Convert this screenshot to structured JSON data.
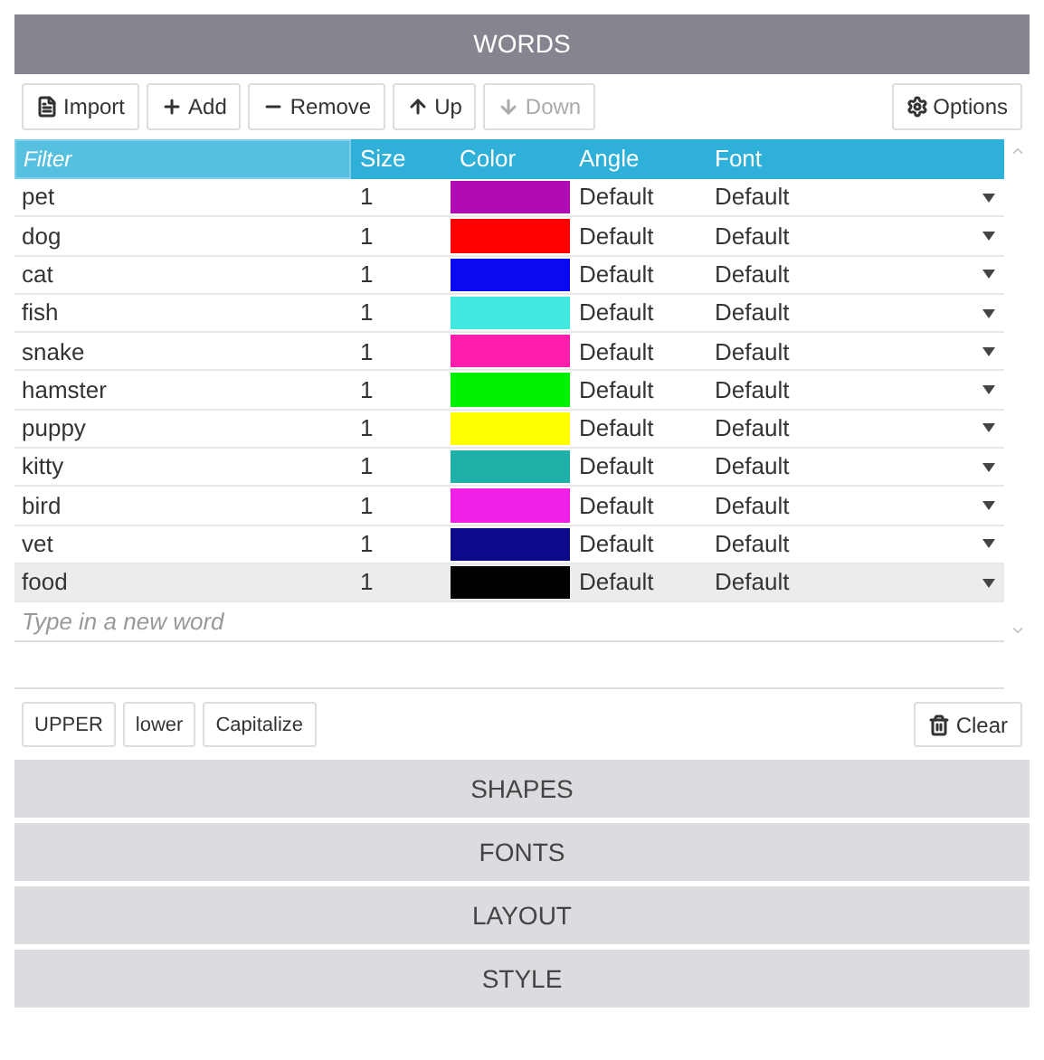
{
  "panel_title": "WORDS",
  "toolbar": [
    {
      "label": "Import",
      "kind": "import",
      "disabled": false
    },
    {
      "label": "Add",
      "kind": "add",
      "disabled": false
    },
    {
      "label": "Remove",
      "kind": "remove",
      "disabled": false
    },
    {
      "label": "Up",
      "kind": "up",
      "disabled": false
    },
    {
      "label": "Down",
      "kind": "down",
      "disabled": true
    }
  ],
  "options_button": "Options",
  "table": {
    "filter_placeholder": "Filter",
    "columns": [
      "Size",
      "Color",
      "Angle",
      "Font"
    ],
    "rows": [
      {
        "word": "pet",
        "size": "1",
        "color": "#b00bb5",
        "angle": "Default",
        "font": "Default",
        "selected": false
      },
      {
        "word": "dog",
        "size": "1",
        "color": "#ff0000",
        "angle": "Default",
        "font": "Default",
        "selected": false
      },
      {
        "word": "cat",
        "size": "1",
        "color": "#0a0af0",
        "angle": "Default",
        "font": "Default",
        "selected": false
      },
      {
        "word": "fish",
        "size": "1",
        "color": "#40e8e0",
        "angle": "Default",
        "font": "Default",
        "selected": false
      },
      {
        "word": "snake",
        "size": "1",
        "color": "#ff1fae",
        "angle": "Default",
        "font": "Default",
        "selected": false
      },
      {
        "word": "hamster",
        "size": "1",
        "color": "#00f000",
        "angle": "Default",
        "font": "Default",
        "selected": false
      },
      {
        "word": "puppy",
        "size": "1",
        "color": "#ffff00",
        "angle": "Default",
        "font": "Default",
        "selected": false
      },
      {
        "word": "kitty",
        "size": "1",
        "color": "#20b0a8",
        "angle": "Default",
        "font": "Default",
        "selected": false
      },
      {
        "word": "bird",
        "size": "1",
        "color": "#f020e8",
        "angle": "Default",
        "font": "Default",
        "selected": false
      },
      {
        "word": "vet",
        "size": "1",
        "color": "#0a0a8a",
        "angle": "Default",
        "font": "Default",
        "selected": false
      },
      {
        "word": "food",
        "size": "1",
        "color": "#000000",
        "angle": "Default",
        "font": "Default",
        "selected": true
      }
    ],
    "new_word_placeholder": "Type in a new word"
  },
  "case_buttons": [
    "UPPER",
    "lower",
    "Capitalize"
  ],
  "clear_button": "Clear",
  "sections": [
    "SHAPES",
    "FONTS",
    "LAYOUT",
    "STYLE"
  ]
}
